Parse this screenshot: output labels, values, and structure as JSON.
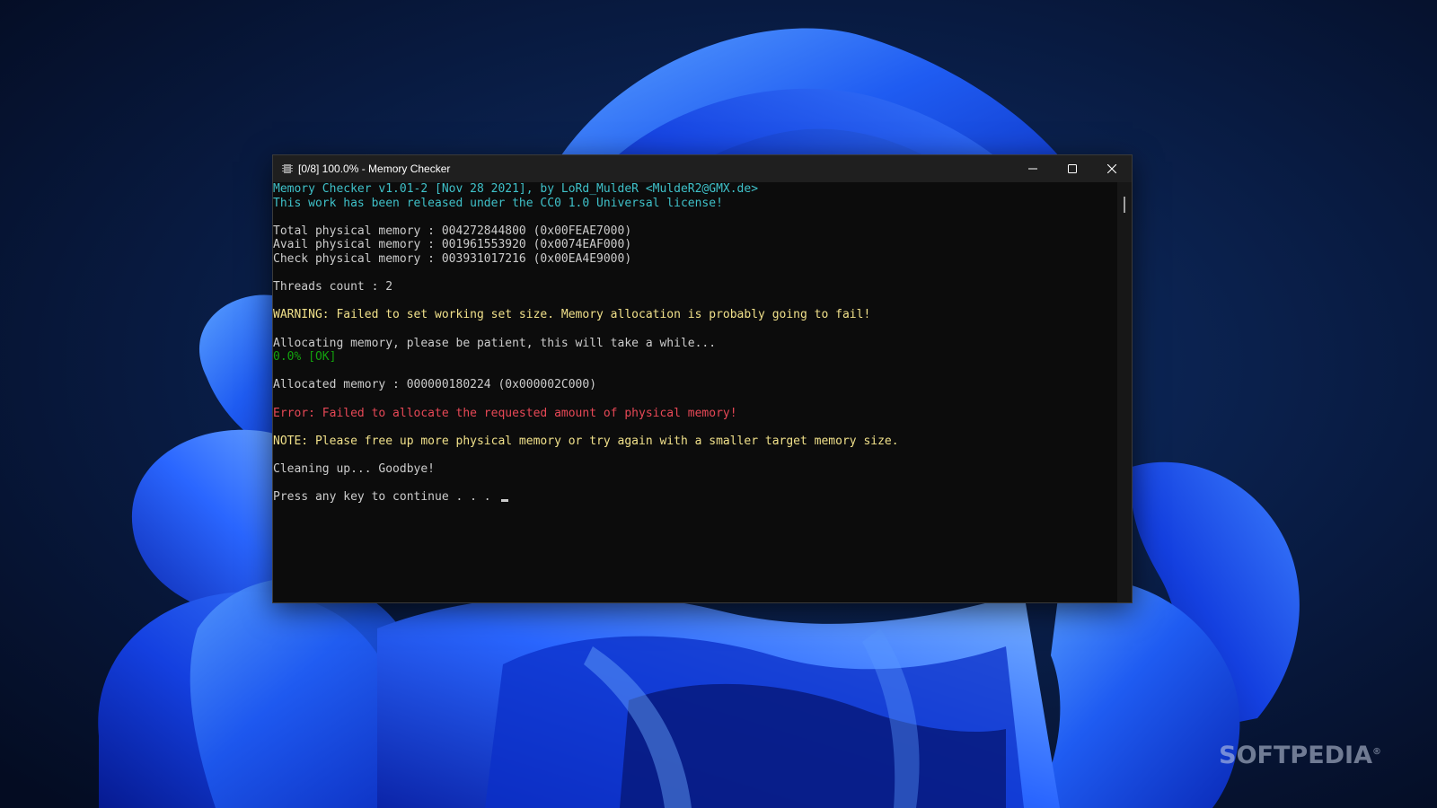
{
  "window": {
    "title": "[0/8] 100.0% - Memory Checker",
    "icon": "memory-chip-icon"
  },
  "controls": {
    "minimize_icon": "minimize-icon",
    "maximize_icon": "maximize-icon",
    "close_icon": "close-icon"
  },
  "console": {
    "lines": [
      {
        "text": "Memory Checker v1.01-2 [Nov 28 2021], by LoRd_MuldeR <MuldeR2@GMX.de>",
        "color": "#3fc1c9"
      },
      {
        "text": "This work has been released under the CC0 1.0 Universal license!",
        "color": "#3fc1c9"
      },
      {
        "text": "",
        "color": "#cccccc"
      },
      {
        "text": "Total physical memory : 004272844800 (0x00FEAE7000)",
        "color": "#cccccc"
      },
      {
        "text": "Avail physical memory : 001961553920 (0x0074EAF000)",
        "color": "#cccccc"
      },
      {
        "text": "Check physical memory : 003931017216 (0x00EA4E9000)",
        "color": "#cccccc"
      },
      {
        "text": "",
        "color": "#cccccc"
      },
      {
        "text": "Threads count : 2",
        "color": "#cccccc"
      },
      {
        "text": "",
        "color": "#cccccc"
      },
      {
        "text": "WARNING: Failed to set working set size. Memory allocation is probably going to fail!",
        "color": "#f0e08a"
      },
      {
        "text": "",
        "color": "#cccccc"
      },
      {
        "text": "Allocating memory, please be patient, this will take a while...",
        "color": "#cccccc"
      },
      {
        "text": "0.0% [OK]",
        "color": "#13a10e"
      },
      {
        "text": "",
        "color": "#cccccc"
      },
      {
        "text": "Allocated memory : 000000180224 (0x000002C000)",
        "color": "#cccccc"
      },
      {
        "text": "",
        "color": "#cccccc"
      },
      {
        "text": "Error: Failed to allocate the requested amount of physical memory!",
        "color": "#e74856"
      },
      {
        "text": "",
        "color": "#cccccc"
      },
      {
        "text": "NOTE: Please free up more physical memory or try again with a smaller target memory size.",
        "color": "#f0e08a"
      },
      {
        "text": "",
        "color": "#cccccc"
      },
      {
        "text": "Cleaning up... Goodbye!",
        "color": "#cccccc"
      },
      {
        "text": "",
        "color": "#cccccc"
      },
      {
        "text": "Press any key to continue . . . ",
        "color": "#cccccc"
      }
    ]
  },
  "watermark": {
    "text": "SOFTPEDIA",
    "mark": "®"
  },
  "colors": {
    "console_bg": "#0c0c0c",
    "titlebar_bg": "#1f1f1f",
    "wallpaper_base": "#061330",
    "wallpaper_blue": "#1a4ff0"
  }
}
